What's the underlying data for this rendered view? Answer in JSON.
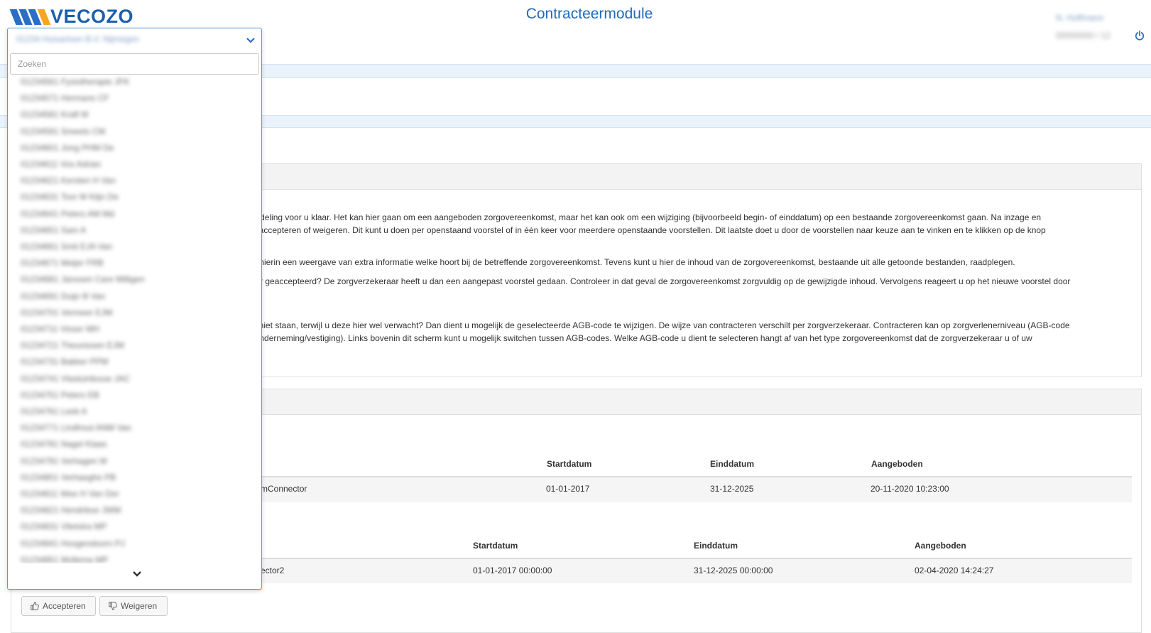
{
  "header": {
    "logo_text": "VECOZO",
    "logo_colors": [
      "#2a6fc4",
      "#2a6fc4",
      "#2a6fc4",
      "#f5a623"
    ],
    "app_title": "Contracteermodule",
    "user_name": "N. Hoffmann",
    "user_sub": "00000000 / 12",
    "power_icon": "power-icon"
  },
  "info_panel": {
    "paragraphs": [
      "eoordeling voor u klaar. Het kan hier gaan om een aangeboden zorgovereenkomst, maar het kan ook om een wijziging (bijvoorbeeld begin- of einddatum) op een bestaande zorgovereenkomst gaan. Na inzage en",
      "eze accepteren of weigeren. Dit kunt u doen per openstaand voorstel of in één keer voor meerdere openstaande voorstellen. Dit laatste doet u door de voorstellen naar keuze aan te vinken en te klikken op de knop",
      "met hierin een weergave van extra informatie welke hoort bij de betreffende zorgovereenkomst. Tevens kunt u hier de inhoud van de zorgovereenkomst, bestaande uit alle getoonde bestanden, raadplegen.",
      "eraar geaccepteerd? De zorgverzekeraar heeft u dan een aangepast voorstel gedaan. Controleer in dat geval de zorgovereenkomst zorgvuldig op de gewijzigde inhoud. Vervolgens reageert u op het nieuwe voorstel door",
      "mst niet staan, terwijl u deze hier wel verwacht? Dan dient u mogelijk de geselecteerde AGB-code te wijzigen. De wijze van contracteren verschilt per zorgverzekeraar. Contracteren kan op zorgverlenerniveau (AGB-code",
      "de onderneming/vestiging). Links bovenin dit scherm kunt u mogelijk switchen tussen AGB-codes. Welke AGB-code u dient te selecteren hangt af van het type zorgovereenkomst dat de zorgverzekeraar u of uw"
    ]
  },
  "table1": {
    "headers": [
      "Startdatum",
      "Einddatum",
      "Aangeboden"
    ],
    "rows": [
      {
        "name": "mConnector",
        "start": "01-01-2017",
        "end": "31-12-2025",
        "offered": "20-11-2020 10:23:00"
      }
    ]
  },
  "table2": {
    "headers": [
      "Startdatum",
      "Einddatum",
      "Aangeboden"
    ],
    "rows": [
      {
        "name": "ector2",
        "start": "01-01-2017 00:00:00",
        "end": "31-12-2025 00:00:00",
        "offered": "02-04-2020 14:24:27"
      }
    ]
  },
  "actions": {
    "accept_label": "Accepteren",
    "reject_label": "Weigeren"
  },
  "agb_dropdown": {
    "selected": "01234 Huisartsen B.V. Nijmegen",
    "search_placeholder": "Zoeken",
    "options": [
      "01234561 Fysiotherapie JFK",
      "01234571 Hermans CF",
      "01234581 Kraft M",
      "01234591 Smeets CM",
      "01234601 Jong PHM De",
      "01234611 Vos Adrian",
      "01234621 Kersten H Van",
      "01234631 Toor M Klijn De",
      "01234641 Peters AM Md",
      "01234651 Sam A",
      "01234661 Smit EJA Van",
      "01234671 Meijer FRB",
      "01234681 Janssen Care Milligen",
      "01234691 Duijn B Van",
      "01234701 Vermeer EJM",
      "01234711 Visser MH",
      "01234721 Theunissen EJM",
      "01234731 Bakker PPM",
      "01234741 Vlastuinbouw JAC",
      "01234751 Peters EB",
      "01234761 Leek A",
      "01234771 Lindhout ANM Van",
      "01234781 Nagel Klaas",
      "01234791 Verhagen M",
      "01234801 Verhaeghe PB",
      "01234811 Wee H Van Der",
      "01234821 Hendrikse JWM",
      "01234831 Vlietstra MP",
      "01234841 Hoogendoorn PJ",
      "01234851 Mollema MP"
    ]
  }
}
